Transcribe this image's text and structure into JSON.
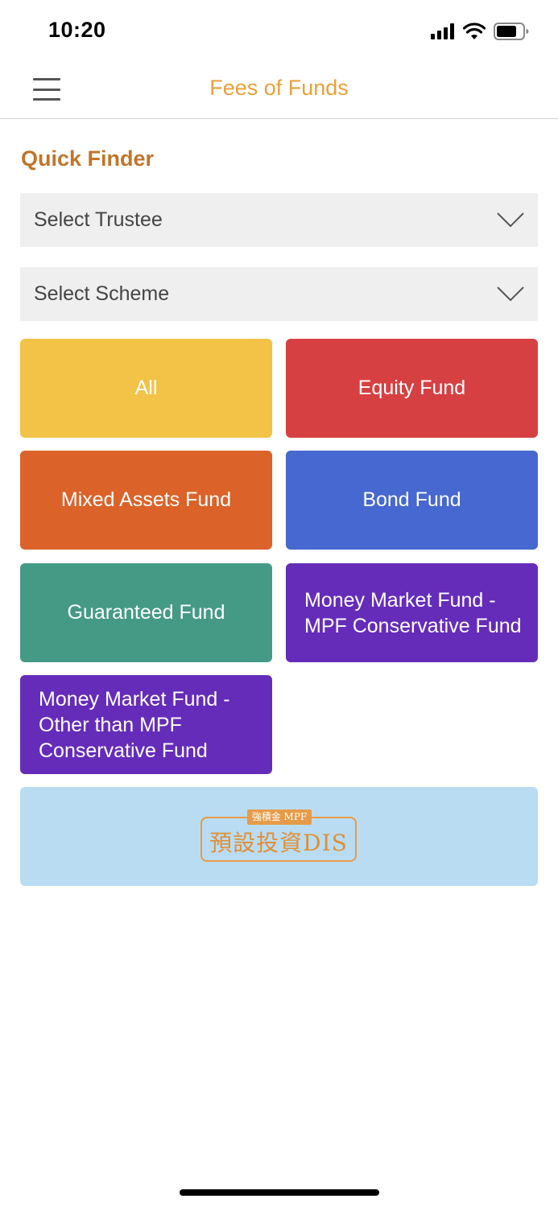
{
  "status_bar": {
    "time": "10:20"
  },
  "nav": {
    "title": "Fees of Funds"
  },
  "quick_finder": {
    "title": "Quick Finder",
    "trustee_select": {
      "value": "Select Trustee"
    },
    "scheme_select": {
      "value": "Select Scheme"
    }
  },
  "categories": [
    {
      "label": "All",
      "color": "#F2C346"
    },
    {
      "label": "Equity Fund",
      "color": "#D64042"
    },
    {
      "label": "Mixed Assets Fund",
      "color": "#DB6329"
    },
    {
      "label": "Bond Fund",
      "color": "#4668D0"
    },
    {
      "label": "Guaranteed Fund",
      "color": "#459A86"
    },
    {
      "label": "Money Market Fund - MPF Conservative Fund",
      "color": "#652CBA"
    },
    {
      "label": "Money Market Fund - Other than MPF Conservative Fund",
      "color": "#652CBA"
    }
  ],
  "dis_banner": {
    "badge": "強積金 MPF",
    "text": "預設投資DIS",
    "background": "#B9DCF3",
    "accent": "#E79B48"
  },
  "colors": {
    "accent": "#E8A03B",
    "section_title": "#C0752A",
    "select_bg": "#EFEFEF"
  }
}
